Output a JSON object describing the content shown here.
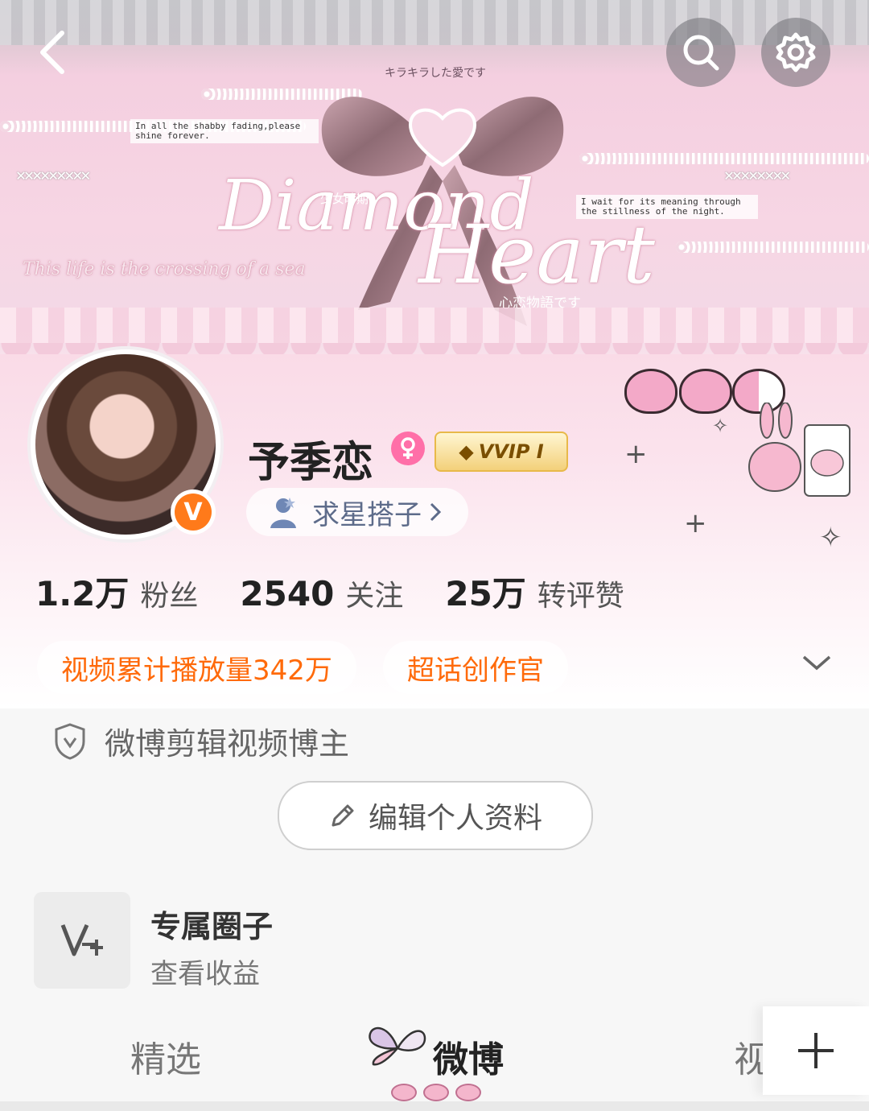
{
  "banner": {
    "top_jp": "キラキラした愛です",
    "quote_left": "In all the shabby fading,please shine forever.",
    "quote_right": "I wait for its meaning through the stillness of the night.",
    "title_small": "少女時期",
    "title_script_1": "Diamond",
    "title_script_2": "Heart",
    "subtitle_script": "This life is the crossing of a sea",
    "bottom_jp": "心恋物語です"
  },
  "header": {
    "back_icon": "back-arrow-icon",
    "search_icon": "search-icon",
    "settings_icon": "gear-icon"
  },
  "profile": {
    "username": "予季恋",
    "vvip_label": "VVIP I",
    "star_pill_label": "求星搭子",
    "stats": [
      {
        "num": "1.2万",
        "label": "粉丝"
      },
      {
        "num": "2540",
        "label": "关注"
      },
      {
        "num": "25万",
        "label": "转评赞"
      }
    ],
    "tags": [
      "视频累计播放量342万",
      "超话创作官"
    ],
    "verification": "微博剪辑视频博主",
    "edit_button": "编辑个人资料"
  },
  "circle": {
    "title": "专属圈子",
    "subtitle": "查看收益"
  },
  "tabs": {
    "items": [
      "精选",
      "微博",
      "视"
    ],
    "active": "微博"
  },
  "colors": {
    "accent_orange": "#ff6a0a",
    "verified_badge": "#ff7a1a",
    "pink": "#f7d6e4"
  }
}
